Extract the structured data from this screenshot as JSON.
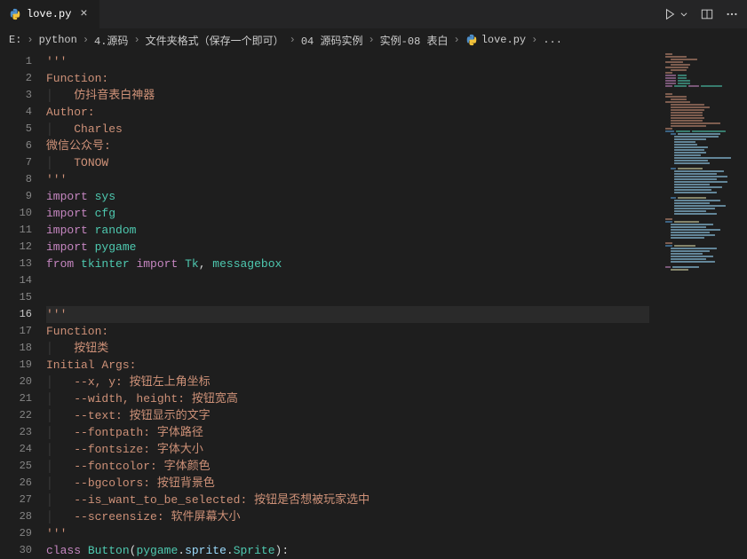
{
  "tab": {
    "label": "love.py"
  },
  "breadcrumb": {
    "b0": "E:",
    "b1": "python",
    "b2": "4.源码",
    "b3": "文件夹格式（保存一个即可）",
    "b4": "04 源码实例",
    "b5": "实例-08 表白",
    "b6": "love.py",
    "b7": "..."
  },
  "ln": {
    "1": "1",
    "2": "2",
    "3": "3",
    "4": "4",
    "5": "5",
    "6": "6",
    "7": "7",
    "8": "8",
    "9": "9",
    "10": "10",
    "11": "11",
    "12": "12",
    "13": "13",
    "14": "14",
    "15": "15",
    "16": "16",
    "17": "17",
    "18": "18",
    "19": "19",
    "20": "20",
    "21": "21",
    "22": "22",
    "23": "23",
    "24": "24",
    "25": "25",
    "26": "26",
    "27": "27",
    "28": "28",
    "29": "29",
    "30": "30"
  },
  "code": {
    "l1": "'''",
    "l2": "Function:",
    "l3_prefix": "    ",
    "l3": "仿抖音表白神器",
    "l4": "Author:",
    "l5_prefix": "    ",
    "l5": "Charles",
    "l6": "微信公众号:",
    "l7_prefix": "    ",
    "l7": "TONOW",
    "l8": "'''",
    "imp": "import",
    "frm": "from",
    "sys": "sys",
    "cfg": "cfg",
    "random": "random",
    "pygame": "pygame",
    "tkinter": "tkinter",
    "Tk": "Tk",
    "comma": ", ",
    "messagebox": "messagebox",
    "l16": "'''",
    "l17": "Function:",
    "l18_prefix": "    ",
    "l18": "按钮类",
    "l19": "Initial Args:",
    "l20_prefix": "    ",
    "l20_arg": "--x, y: ",
    "l20_desc": "按钮左上角坐标",
    "l21_prefix": "    ",
    "l21_arg": "--width, height: ",
    "l21_desc": "按钮宽高",
    "l22_prefix": "    ",
    "l22_arg": "--text: ",
    "l22_desc": "按钮显示的文字",
    "l23_prefix": "    ",
    "l23_arg": "--fontpath: ",
    "l23_desc": "字体路径",
    "l24_prefix": "    ",
    "l24_arg": "--fontsize: ",
    "l24_desc": "字体大小",
    "l25_prefix": "    ",
    "l25_arg": "--fontcolor: ",
    "l25_desc": "字体颜色",
    "l26_prefix": "    ",
    "l26_arg": "--bgcolors: ",
    "l26_desc": "按钮背景色",
    "l27_prefix": "    ",
    "l27_arg": "--is_want_to_be_selected: ",
    "l27_desc": "按钮是否想被玩家选中",
    "l28_prefix": "    ",
    "l28_arg": "--screensize: ",
    "l28_desc": "软件屏幕大小",
    "l29": "'''",
    "class_kw": "class",
    "class_sp": " ",
    "class_name": "Button",
    "paren_open": "(",
    "sprite_mod1": "pygame",
    "dot1": ".",
    "sprite_mod2": "sprite",
    "dot2": ".",
    "sprite_cls": "Sprite",
    "paren_close": ")",
    "colon": ":"
  }
}
